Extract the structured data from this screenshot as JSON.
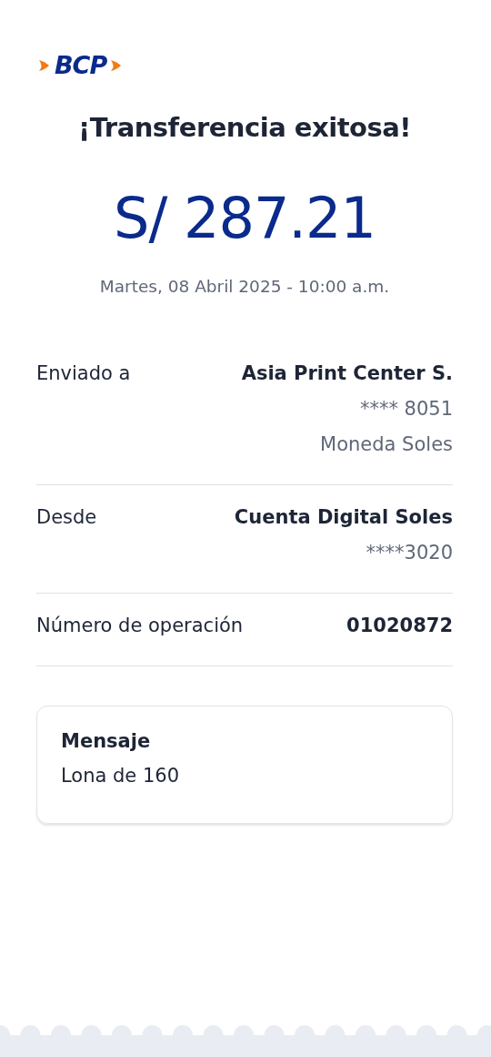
{
  "logo": {
    "text": "BCP"
  },
  "title": "¡Transferencia exitosa!",
  "amount": "S/ 287.21",
  "date": "Martes, 08 Abril 2025 - 10:00 a.m.",
  "details": [
    {
      "label": "Enviado a",
      "value": "Asia Print Center S.",
      "extra": [
        "**** 8051",
        "Moneda Soles"
      ]
    },
    {
      "label": "Desde",
      "value": "Cuenta Digital Soles",
      "extra": [
        "****3020"
      ]
    },
    {
      "label": "Número de operación",
      "value": "01020872"
    }
  ],
  "message": {
    "title": "Mensaje",
    "text": "Lona de 160"
  }
}
